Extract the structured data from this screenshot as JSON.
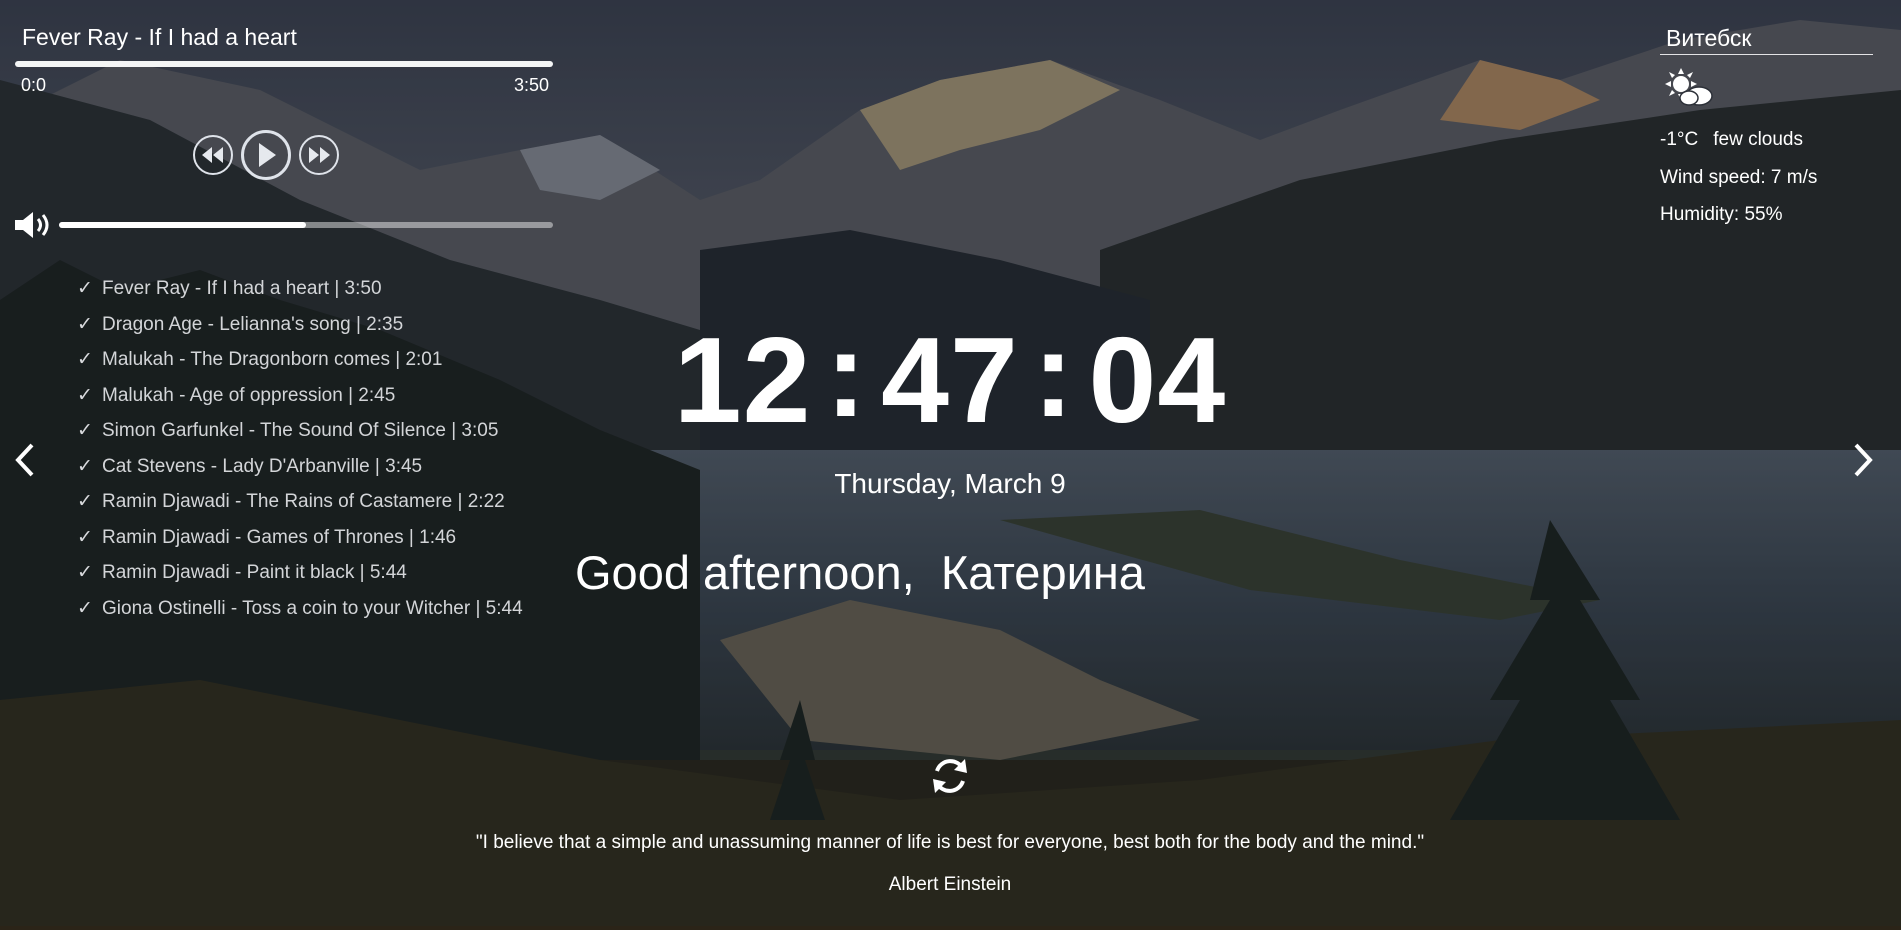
{
  "player": {
    "track_title": "Fever Ray - If I had a heart",
    "current_time": "0:0",
    "duration": "3:50",
    "progress_fraction": 0.0,
    "volume_fraction": 0.5,
    "icons": {
      "rewind": "rewind-icon",
      "play": "play-icon",
      "fast_forward": "fast-forward-icon",
      "volume": "speaker-icon"
    },
    "playlist": [
      {
        "label": "Fever Ray - If I had a heart | 3:50"
      },
      {
        "label": "Dragon Age - Lelianna's song | 2:35"
      },
      {
        "label": "Malukah - The Dragonborn comes | 2:01"
      },
      {
        "label": "Malukah - Age of oppression | 2:45"
      },
      {
        "label": "Simon Garfunkel - The Sound Of Silence | 3:05"
      },
      {
        "label": "Cat Stevens - Lady D'Arbanville | 3:45"
      },
      {
        "label": "Ramin Djawadi - The Rains of Castamere | 2:22"
      },
      {
        "label": "Ramin Djawadi - Games of Thrones | 1:46"
      },
      {
        "label": "Ramin Djawadi - Paint it black | 5:44"
      },
      {
        "label": "Giona Ostinelli - Toss a coin to your Witcher | 5:44"
      }
    ],
    "check_mark": "✓"
  },
  "weather": {
    "city": "Витебск",
    "icon": "few-clouds-icon",
    "temperature": "-1°C",
    "description": "few clouds",
    "wind": "Wind speed: 7 m/s",
    "humidity": "Humidity: 55%"
  },
  "clock": {
    "hours": "12",
    "minutes": "47",
    "seconds": "04",
    "separator": ":"
  },
  "date": "Thursday, March 9",
  "greeting": {
    "salutation": "Good afternoon,",
    "name": "Катерина"
  },
  "quote": {
    "text": "\"I believe that a simple and unassuming manner of life is best for everyone, best both for the body and the mind.\"",
    "author": "Albert Einstein",
    "refresh_icon": "refresh-icon"
  },
  "navigation": {
    "prev_icon": "chevron-left-icon",
    "next_icon": "chevron-right-icon"
  }
}
